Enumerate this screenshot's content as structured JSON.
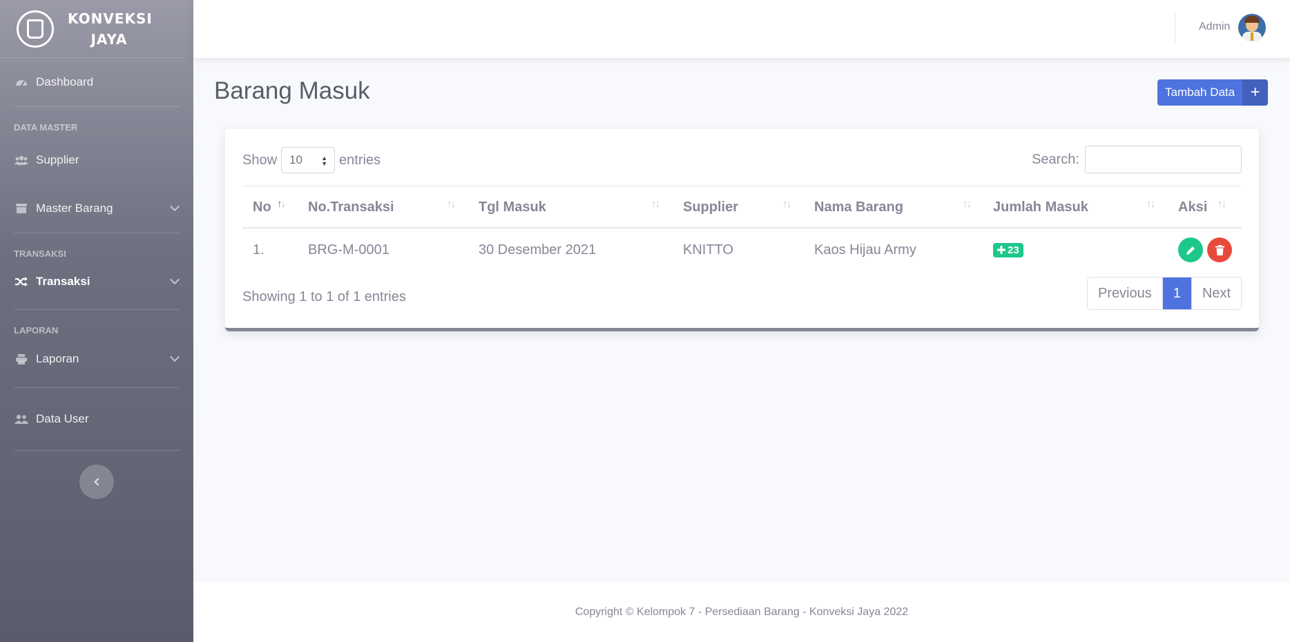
{
  "brand": {
    "line1": "KONVEKSI",
    "line2": "JAYA",
    "logo_icon": "shirt-icon"
  },
  "sidebar": {
    "dashboard": {
      "label": "Dashboard",
      "icon": "tachometer-icon"
    },
    "heading_master": "DATA MASTER",
    "supplier": {
      "label": "Supplier",
      "icon": "users-icon"
    },
    "master_barang": {
      "label": "Master Barang",
      "icon": "box-icon"
    },
    "heading_transaksi": "TRANSAKSI",
    "transaksi": {
      "label": "Transaksi",
      "icon": "random-icon"
    },
    "heading_laporan": "LAPORAN",
    "laporan": {
      "label": "Laporan",
      "icon": "print-icon"
    },
    "data_user": {
      "label": "Data User",
      "icon": "user-friends-icon"
    }
  },
  "topbar": {
    "user_name": "Admin"
  },
  "page": {
    "title": "Barang Masuk",
    "add_label": "Tambah Data",
    "add_icon": "+"
  },
  "table": {
    "show_label": "Show",
    "entries_value": "10",
    "entries_label": "entries",
    "search_label": "Search:",
    "search_value": "",
    "columns": [
      "No",
      "No.Transaksi",
      "Tgl Masuk",
      "Supplier",
      "Nama Barang",
      "Jumlah Masuk",
      "Aksi"
    ],
    "rows": [
      {
        "no": "1.",
        "no_transaksi": "BRG-M-0001",
        "tgl_masuk": "30 Desember 2021",
        "supplier": "KNITTO",
        "nama_barang": "Kaos Hijau Army",
        "jumlah": "23"
      }
    ],
    "info": "Showing 1 to 1 of 1 entries",
    "pagination": {
      "previous": "Previous",
      "current": "1",
      "next": "Next"
    }
  },
  "footer": {
    "text": "Copyright © Kelompok 7 - Persediaan Barang - Konveksi Jaya 2022"
  },
  "colors": {
    "primary": "#4e73df",
    "success": "#1cc88a",
    "danger": "#e74a3b"
  }
}
